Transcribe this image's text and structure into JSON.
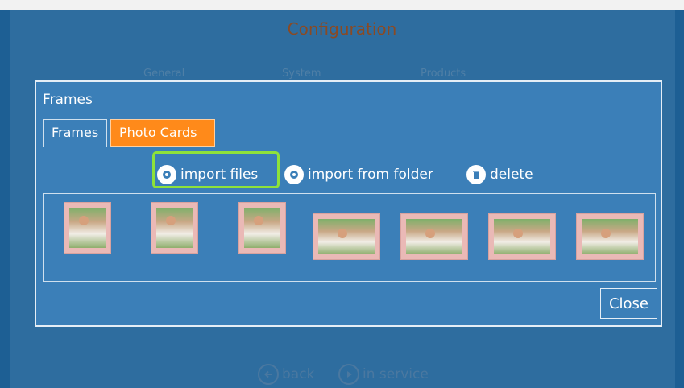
{
  "app": {
    "title": "Configuration"
  },
  "nav_tabs": [
    {
      "label": "General"
    },
    {
      "label": "System"
    },
    {
      "label": "Products"
    }
  ],
  "dialog": {
    "title": "Frames",
    "tabs": [
      {
        "label": "Frames",
        "active": false
      },
      {
        "label": "Photo Cards",
        "active": true
      }
    ],
    "actions": {
      "import_files": {
        "label": "import files",
        "icon": "gear-icon"
      },
      "import_folder": {
        "label": "import from folder",
        "icon": "gear-icon"
      },
      "delete": {
        "label": "delete",
        "icon": "trash-icon"
      }
    },
    "thumbnails": [
      {
        "orientation": "portrait"
      },
      {
        "orientation": "portrait"
      },
      {
        "orientation": "portrait"
      },
      {
        "orientation": "landscape"
      },
      {
        "orientation": "landscape"
      },
      {
        "orientation": "landscape"
      },
      {
        "orientation": "landscape"
      }
    ],
    "close_label": "Close"
  },
  "bottom_nav": {
    "back_label": "back",
    "in_service_label": "in service"
  },
  "colors": {
    "accent": "#ff8a1a",
    "highlight": "#8ee23a",
    "background": "#1d5f94",
    "dialog": "#3b7fb8"
  }
}
